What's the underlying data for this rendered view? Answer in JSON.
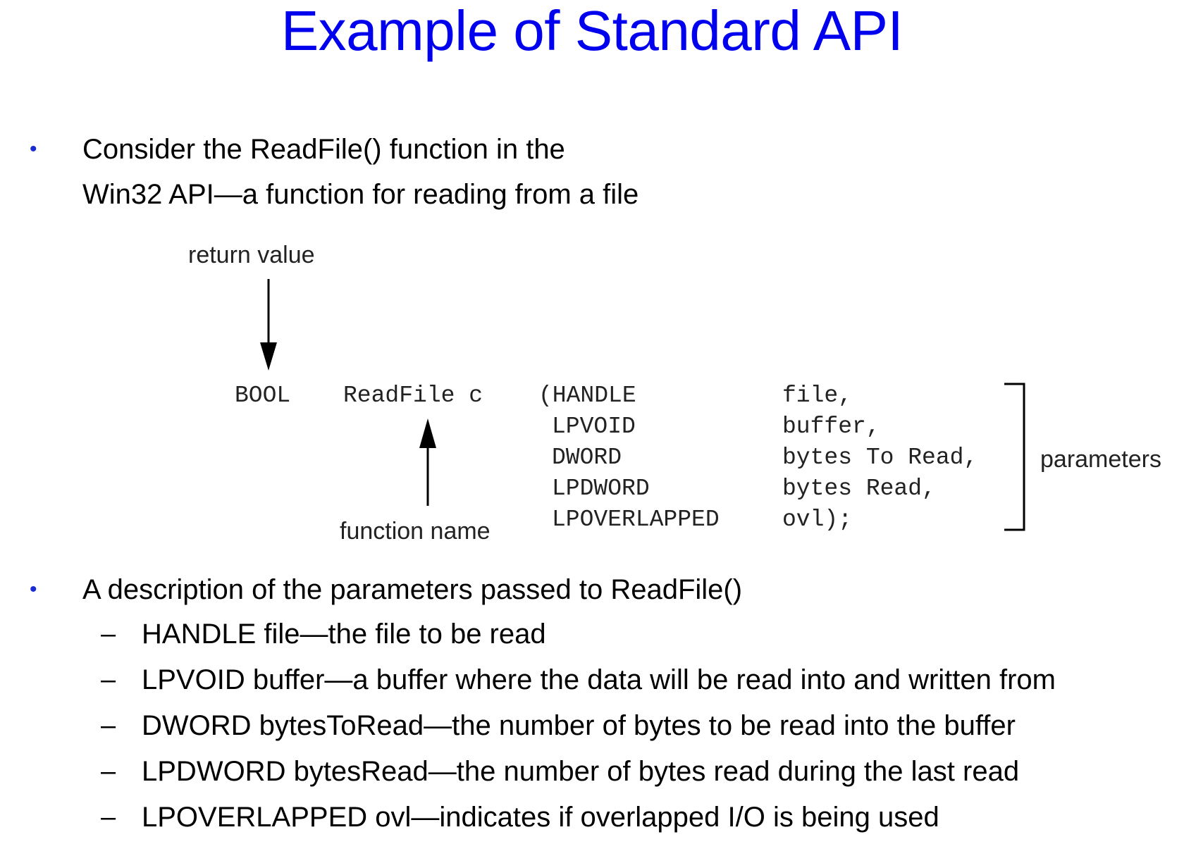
{
  "title": "Example of Standard API",
  "bullet_symbol": "•",
  "dash_symbol": "–",
  "bullets": [
    {
      "lines": [
        "Consider the ReadFile() function in the",
        "Win32 API—a function for reading from a file"
      ]
    },
    {
      "lines": [
        "A description of the parameters passed to ReadFile()"
      ]
    }
  ],
  "diagram": {
    "return_label": "return value",
    "function_label": "function name",
    "params_label": "parameters",
    "return_type": "BOOL",
    "function_name": "ReadFile c",
    "params": [
      {
        "type": "(HANDLE",
        "name": "file,"
      },
      {
        "type": "LPVOID",
        "name": "buffer,"
      },
      {
        "type": "DWORD",
        "name": "bytes To Read,"
      },
      {
        "type": "LPDWORD",
        "name": "bytes Read,"
      },
      {
        "type": "LPOVERLAPPED",
        "name": "ovl);"
      }
    ]
  },
  "sub_items": [
    "HANDLE file—the file to be read",
    "LPVOID buffer—a buffer where the data will be read into and written from",
    "DWORD bytesToRead—the number of bytes to be read into the buffer",
    "LPDWORD bytesRead—the number of bytes read during the last read",
    "LPOVERLAPPED ovl—indicates if overlapped I/O is being used"
  ]
}
